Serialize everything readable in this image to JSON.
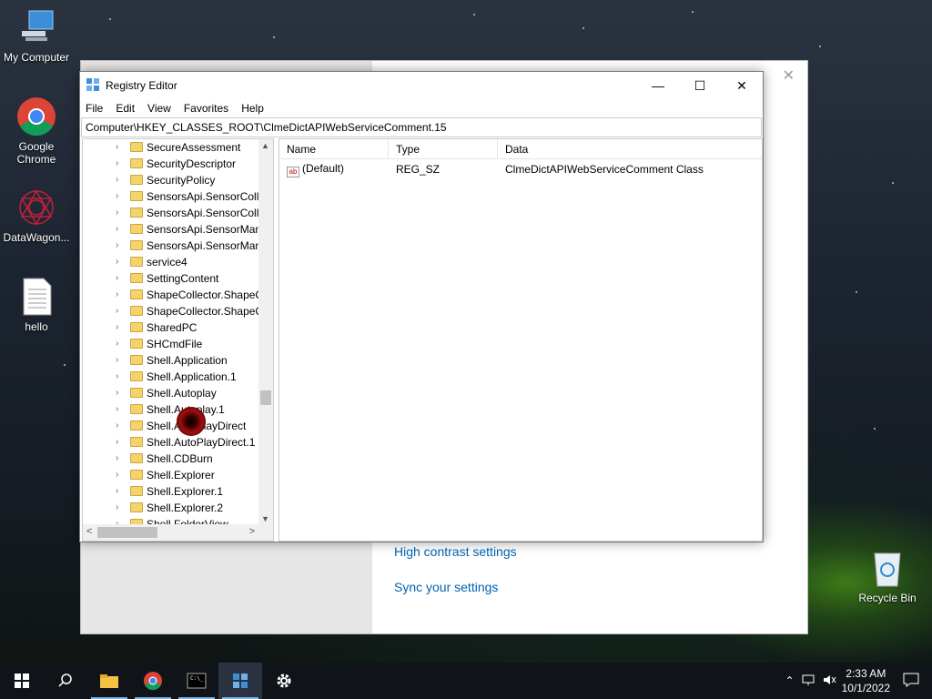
{
  "desktop": {
    "icons": [
      {
        "label": "My Computer"
      },
      {
        "label": "Google Chrome"
      },
      {
        "label": "DataWagon..."
      },
      {
        "label": "hello"
      },
      {
        "label": "Recycle Bin"
      }
    ]
  },
  "settings_window": {
    "links": [
      "High contrast settings",
      "Sync your settings"
    ]
  },
  "registry_editor": {
    "title": "Registry Editor",
    "menu": [
      "File",
      "Edit",
      "View",
      "Favorites",
      "Help"
    ],
    "address": "Computer\\HKEY_CLASSES_ROOT\\ClmeDictAPIWebServiceComment.15",
    "tree_items": [
      "SecureAssessment",
      "SecurityDescriptor",
      "SecurityPolicy",
      "SensorsApi.SensorColle",
      "SensorsApi.SensorColle",
      "SensorsApi.SensorMana",
      "SensorsApi.SensorMana",
      "service4",
      "SettingContent",
      "ShapeCollector.ShapeC",
      "ShapeCollector.ShapeC",
      "SharedPC",
      "SHCmdFile",
      "Shell.Application",
      "Shell.Application.1",
      "Shell.Autoplay",
      "Shell.Autoplay.1",
      "Shell.AutoPlayDirect",
      "Shell.AutoPlayDirect.1",
      "Shell.CDBurn",
      "Shell.Explorer",
      "Shell.Explorer.1",
      "Shell.Explorer.2",
      "Shell.FolderView"
    ],
    "columns": [
      "Name",
      "Type",
      "Data"
    ],
    "values": [
      {
        "name": "(Default)",
        "type": "REG_SZ",
        "data": "ClmeDictAPIWebServiceComment Class"
      }
    ]
  },
  "taskbar": {
    "time": "2:33 AM",
    "date": "10/1/2022"
  }
}
